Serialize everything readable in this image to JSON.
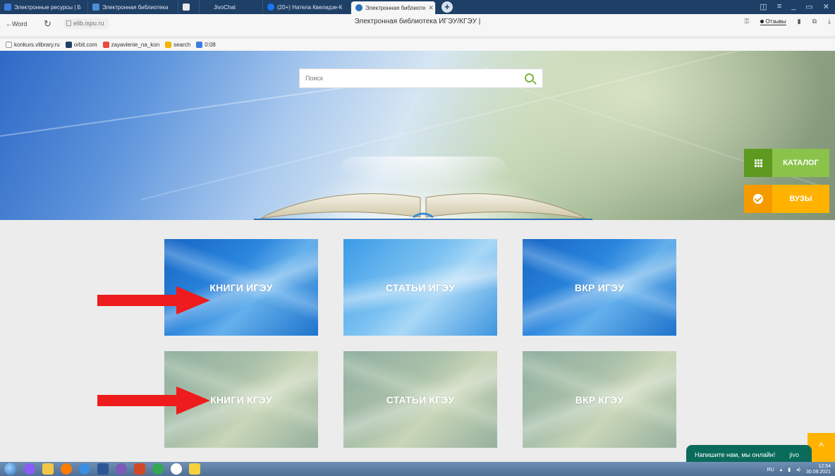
{
  "browser": {
    "tabs": [
      {
        "label": "Электронные ресурсы | Б",
        "color": "#3b7ddd"
      },
      {
        "label": "Электронная библиотека",
        "color": "#4c8ed6"
      },
      {
        "label": "",
        "color": "#3a3a3a"
      },
      {
        "label": "JivoChat",
        "color": "#1e3f66"
      },
      {
        "label": "(20+) Натела Квелидзе-К",
        "color": "#1877f2"
      },
      {
        "label": "Электронная библиоте",
        "color": "#2b6fb8",
        "active": true
      }
    ],
    "back_label": "←Word",
    "url": "elib.ispu.ru",
    "page_title": "Электронная библиотека ИГЭУ/КГЭУ |",
    "reviews_label": "Отзывы",
    "bookmarks": [
      {
        "label": "konkurs.vlibrary.ru",
        "color": "#999999"
      },
      {
        "label": "orbit.com",
        "color": "#1e3f66"
      },
      {
        "label": "zayavlenie_na_kon",
        "color": "#e84c3d"
      },
      {
        "label": "search",
        "color": "#f4b400"
      },
      {
        "label": "0:08",
        "color": "#3b7ddd"
      }
    ]
  },
  "search": {
    "placeholder": "Поиск"
  },
  "side_buttons": {
    "catalog": "КАТАЛОГ",
    "vuzy": "ВУЗЫ"
  },
  "tiles": [
    {
      "label": "КНИГИ ИГЭУ"
    },
    {
      "label": "СТАТЬИ ИГЭУ"
    },
    {
      "label": "ВКР ИГЭУ"
    },
    {
      "label": "КНИГИ КГЭУ"
    },
    {
      "label": "СТАТЬИ КГЭУ"
    },
    {
      "label": "ВКР КГЭУ"
    }
  ],
  "chat": {
    "text": "Напишите нам, мы онлайн!",
    "brand": "jivo"
  },
  "taskbar": {
    "lang": "RU",
    "time": "12:54",
    "date": "30.09.2021"
  },
  "colors": {
    "accent_green": "#8bc34a",
    "accent_orange": "#ffb300",
    "annotation_arrow": "#ee1c1c"
  }
}
